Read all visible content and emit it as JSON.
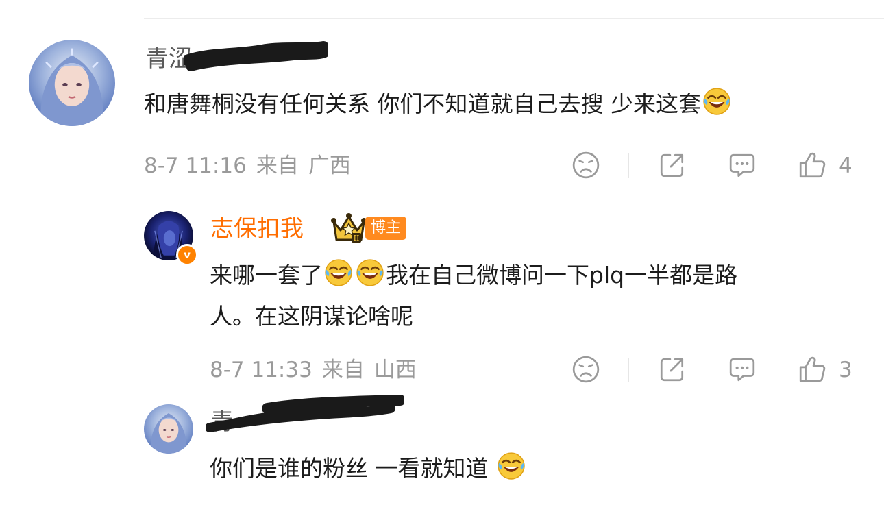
{
  "comments": [
    {
      "author": "青涩",
      "text_lines": [
        "和唐舞桐没有任何关系 你们不知道就自己去搜 少来这套"
      ],
      "emoji": "laughing-tears",
      "date": "8-7 11:16",
      "from_label": "来自",
      "location": "广西",
      "likes": "4"
    },
    {
      "author": "志保扣我",
      "role_badge": "博主",
      "crown_level": "II",
      "verified_mark": "v",
      "text_part1": "来哪一套了",
      "text_part2": "我在自己微博问一下plq一半都是路",
      "text_line2": "人。在这阴谋论啥呢",
      "date": "8-7 11:33",
      "from_label": "来自",
      "location": "山西",
      "likes": "3"
    },
    {
      "author": "青",
      "text_lines": [
        "你们是谁的粉丝 一看就知道"
      ]
    }
  ],
  "colors": {
    "author_highlight": "#ff6d00",
    "badge_bg": "#ff8a1f",
    "meta_gray": "#9a9a9a",
    "icon_gray": "#9a9a9a"
  },
  "icons": [
    "sad-face-icon",
    "share-icon",
    "comment-icon",
    "like-icon",
    "crown-icon",
    "verified-icon",
    "laughing-tears-emoji"
  ]
}
